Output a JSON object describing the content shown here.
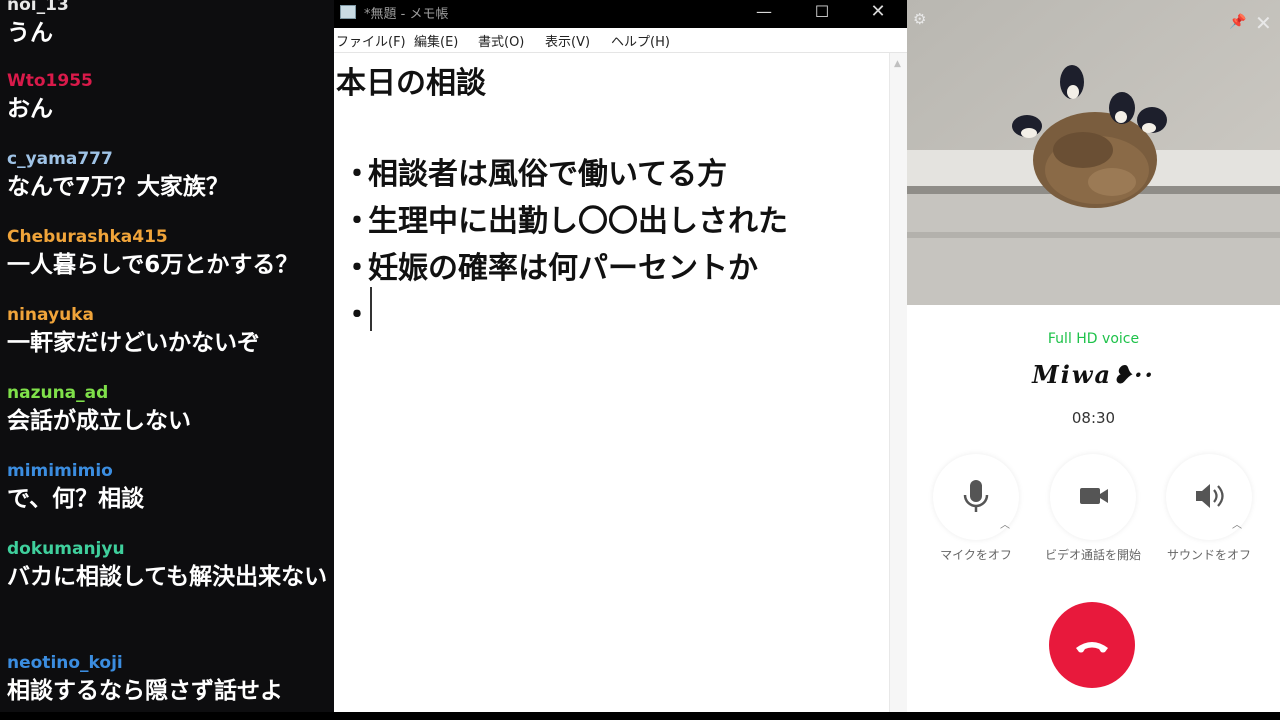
{
  "chat": {
    "messages": [
      {
        "user": "noi_13",
        "text": "うん",
        "user_color": "#e8e8e8"
      },
      {
        "user": "Wto1955",
        "text": "おん",
        "user_color": "#d91a4a"
      },
      {
        "user": "c_yama777",
        "text": "なんで7万？大家族？",
        "user_color": "#9fc3e6"
      },
      {
        "user": "Cheburashka415",
        "text": "一人暮らしで6万とかする？",
        "user_color": "#f0a43a"
      },
      {
        "user": "ninayuka",
        "text": "一軒家だけどいかないぞ",
        "user_color": "#f0a43a"
      },
      {
        "user": "nazuna_ad",
        "text": "会話が成立しない",
        "user_color": "#7fe04a"
      },
      {
        "user": "mimimimio",
        "text": "で、何？相談",
        "user_color": "#3b8de0"
      },
      {
        "user": "dokumanjyu",
        "text": "バカに相談しても解決出来ない",
        "user_color": "#3fcf9c"
      },
      {
        "user": "neotino_koji",
        "text": "相談するなら隠さず話せよ",
        "user_color": "#3b8de0"
      }
    ]
  },
  "notepad": {
    "title": "*無題 - メモ帳",
    "window_controls": {
      "minimize": "—",
      "maximize": "☐",
      "close": "✕"
    },
    "menu": [
      "ファイル(F)",
      "編集(E)",
      "書式(O)",
      "表示(V)",
      "ヘルプ(H)"
    ],
    "heading": "本日の相談",
    "bullet_char": "・",
    "bullets": [
      "相談者は風俗で働いてる方",
      "生理中に出勤し〇〇出しされた",
      "妊娠の確率は何パーセントか",
      ""
    ]
  },
  "call": {
    "hd_label": "Full HD voice",
    "caller_name": "Miwa❥··",
    "timer": "08:30",
    "controls": [
      {
        "label": "マイクをオフ",
        "icon": "microphone-icon"
      },
      {
        "label": "ビデオ通話を開始",
        "icon": "video-camera-icon"
      },
      {
        "label": "サウンドをオフ",
        "icon": "speaker-icon"
      }
    ],
    "hangup_icon": "phone-hangup-icon",
    "accent_green": "#1ec24a",
    "hangup_red": "#e8193c"
  }
}
